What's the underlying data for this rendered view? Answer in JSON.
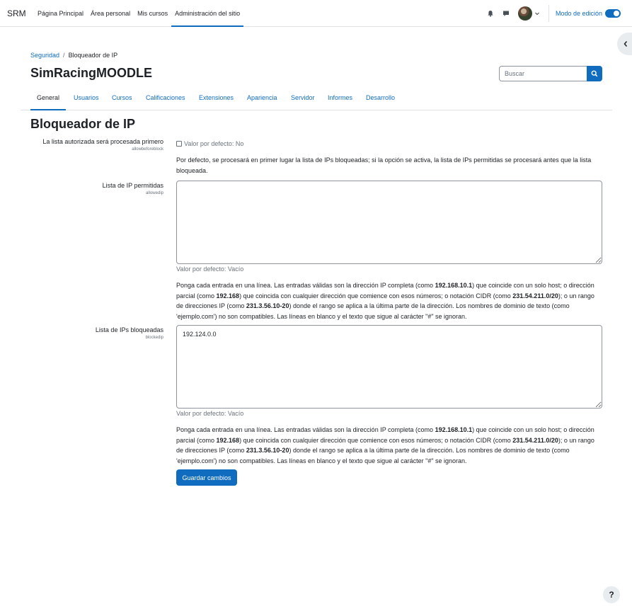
{
  "navbar": {
    "brand": "SRM",
    "items": [
      {
        "label": "Página Principal"
      },
      {
        "label": "Área personal"
      },
      {
        "label": "Mis cursos"
      },
      {
        "label": "Administración del sitio"
      }
    ],
    "edit_mode_label": "Modo de edición",
    "edit_mode_on": true
  },
  "breadcrumb": {
    "parent": "Seguridad",
    "current": "Bloqueador de IP"
  },
  "page_heading": "SimRacingMOODLE",
  "search": {
    "placeholder": "Buscar"
  },
  "tabs": [
    {
      "label": "General"
    },
    {
      "label": "Usuarios"
    },
    {
      "label": "Cursos"
    },
    {
      "label": "Calificaciones"
    },
    {
      "label": "Extensiones"
    },
    {
      "label": "Apariencia"
    },
    {
      "label": "Servidor"
    },
    {
      "label": "Informes"
    },
    {
      "label": "Desarrollo"
    }
  ],
  "section_title": "Bloqueador de IP",
  "settings": {
    "allowbeforeblock": {
      "label": "La lista autorizada será procesada primero",
      "name": "allowbeforeblock",
      "checked": false,
      "default_text": "Valor por defecto: No",
      "description": "Por defecto, se procesará en primer lugar la lista de IPs bloqueadas; si la opción se activa, la lista de IPs permitidas se procesará antes que la lista bloqueada."
    },
    "allowedip": {
      "label": "Lista de IP permitidas",
      "name": "allowedip",
      "value": "",
      "default_text": "Valor por defecto: Vacío"
    },
    "blockedip": {
      "label": "Lista de IPs bloqueadas",
      "name": "blockedip",
      "value": "192.124.0.0",
      "default_text": "Valor por defecto: Vacío"
    },
    "help_text": {
      "p1": "Ponga cada entrada en una línea. Las entradas válidas son la dirección IP completa (como ",
      "ex1": "192.168.10.1",
      "p2": ") que coincide con un solo host; o dirección parcial (como ",
      "ex2": "192.168",
      "p3": ") que coincida con cualquier dirección que comience con esos números; o notación CIDR (como ",
      "ex3": "231.54.211.0/20",
      "p4": "); o un rango de direcciones IP (como ",
      "ex4": "231.3.56.10-20",
      "p5": ") donde el rango se aplica a la última parte de la dirección. Los nombres de dominio de texto (como 'ejemplo.com') no son compatibles. Las líneas en blanco y el texto que sigue al carácter \"#\" se ignoran."
    }
  },
  "save_button": "Guardar cambios",
  "help_button": "?"
}
